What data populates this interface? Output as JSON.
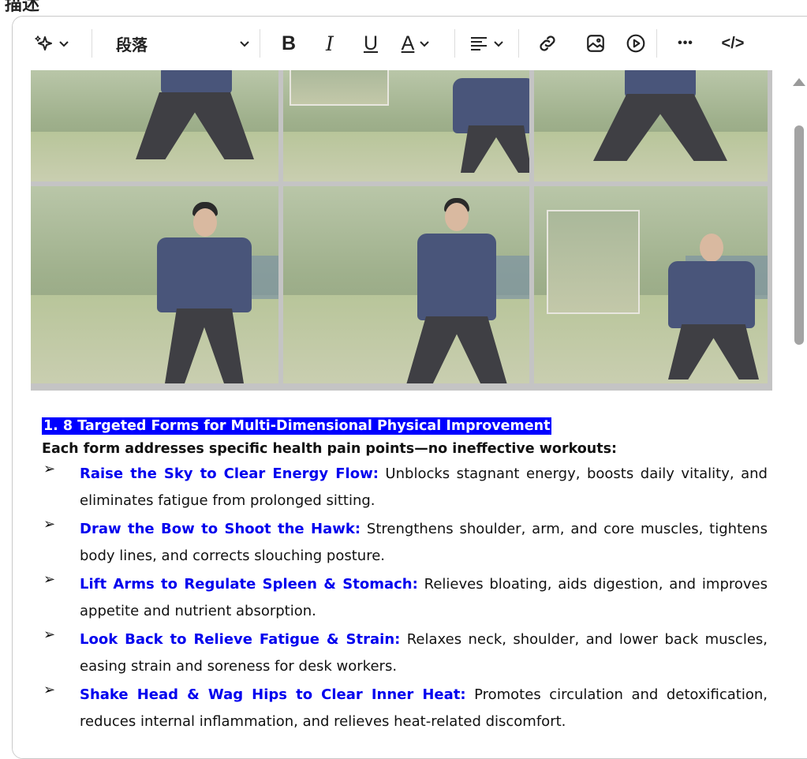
{
  "page": {
    "top_label": "描述"
  },
  "toolbar": {
    "ai_icon": "sparkle-icon",
    "paragraph_label": "段落",
    "bold": "B",
    "italic": "I",
    "underline": "U",
    "font_color": "A",
    "align_icon": "align-left-icon",
    "link_icon": "link-icon",
    "image_icon": "image-icon",
    "video_icon": "video-icon",
    "more_label": "•••",
    "code_label": "</>"
  },
  "document": {
    "heading": "1. 8 Targeted Forms for Multi-Dimensional Physical Improvement",
    "intro": "Each form addresses specific health pain points—no ineffective workouts:",
    "bullet_symbol": "➢",
    "items": [
      {
        "title": "Raise the Sky to Clear Energy Flow:",
        "text": " Unblocks stagnant energy, boosts daily vitality, and eliminates fatigue from prolonged sitting."
      },
      {
        "title": "Draw the Bow to Shoot the Hawk:",
        "text": " Strengthens shoulder, arm, and core muscles, tightens body lines, and corrects slouching posture."
      },
      {
        "title": "Lift Arms to Regulate Spleen & Stomach:",
        "text": " Relieves bloating, aids digestion, and improves appetite and nutrient absorption."
      },
      {
        "title": "Look Back to Relieve Fatigue & Strain:",
        "text": " Relaxes neck, shoulder, and lower back muscles, easing strain and soreness for desk workers."
      },
      {
        "title": "Shake Head & Wag Hips to Clear Inner Heat:",
        "text": " Promotes circulation and detoxification, reduces internal inflammation, and relieves heat-related discomfort."
      }
    ]
  }
}
